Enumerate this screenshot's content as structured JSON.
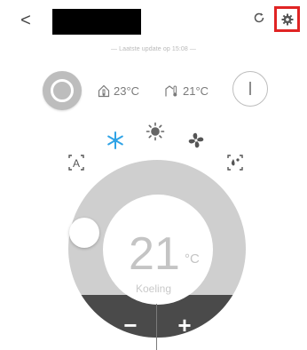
{
  "header": {
    "back_label": "<",
    "title": "",
    "refresh_icon": "refresh-icon",
    "settings_icon": "gear-icon",
    "settings_highlight_color": "#e02424"
  },
  "update_text": "— Laatste update op 15:08 —",
  "status": {
    "indoor_temp": "23°C",
    "outdoor_temp": "21°C",
    "indoor_icon": "house-temperature-icon",
    "outdoor_icon": "outdoor-temperature-icon",
    "power_icon": "power-icon"
  },
  "modes": {
    "items": [
      {
        "name": "auto",
        "label": "A",
        "icon": "auto-mode-icon"
      },
      {
        "name": "cool",
        "icon": "snowflake-icon",
        "color": "#2fa3e6"
      },
      {
        "name": "heat",
        "icon": "sun-icon"
      },
      {
        "name": "fan",
        "icon": "fan-icon"
      },
      {
        "name": "dry",
        "icon": "dry-mode-icon"
      }
    ]
  },
  "thermostat": {
    "set_temperature": "21",
    "unit": "°C",
    "mode_label": "Koeling",
    "decrease_label": "−",
    "increase_label": "+"
  }
}
